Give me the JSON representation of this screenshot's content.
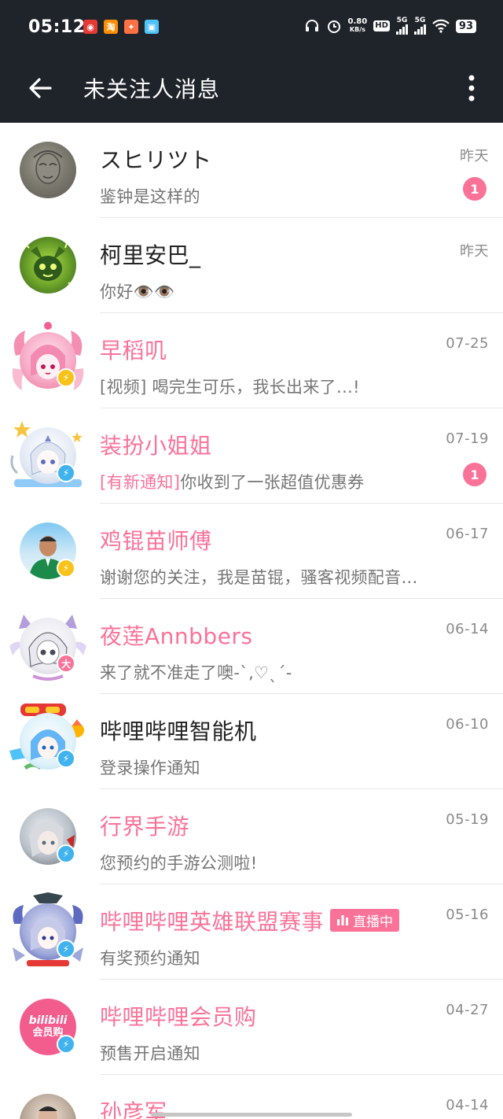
{
  "status_bar": {
    "time": "05:12",
    "net_speed_value": "0.80",
    "net_speed_unit": "KB/s",
    "hd_label": "HD",
    "sim1_label": "5G",
    "sim2_label": "5G",
    "battery": "93"
  },
  "header": {
    "title": "未关注人消息"
  },
  "messages": [
    {
      "name": "スヒリツト",
      "preview": "鉴钟是这样的",
      "date": "昨天",
      "unread": "1"
    },
    {
      "name": "柯里安巴_",
      "preview": "你好👁️👁️",
      "date": "昨天"
    },
    {
      "name": "早稻叽",
      "preview": "[视频] 喝完生可乐，我长出来了…!",
      "date": "07-25"
    },
    {
      "name": "装扮小姐姐",
      "notice_tag": "[有新通知]",
      "preview": "你收到了一张超值优惠券",
      "date": "07-19",
      "unread": "1"
    },
    {
      "name": "鸡锟苗师傅",
      "preview": "谢谢您的关注，我是苗锟，骚客视频配音…",
      "date": "06-17"
    },
    {
      "name": "夜莲Annbbers",
      "preview": "来了就不准走了噢-ˋ,♡ˎˊ-",
      "date": "06-14",
      "badge": "大"
    },
    {
      "name": "哔哩哔哩智能机",
      "preview": "登录操作通知",
      "date": "06-10"
    },
    {
      "name": "行界手游",
      "preview": "您预约的手游公测啦!",
      "date": "05-19"
    },
    {
      "name": "哔哩哔哩英雄联盟赛事",
      "live_label": "直播中",
      "preview": "有奖预约通知",
      "date": "05-16"
    },
    {
      "name": "哔哩哔哩会员购",
      "preview": "预售开启通知",
      "date": "04-27",
      "avatar_text_top": "bilibili",
      "avatar_text_bottom": "会员购"
    },
    {
      "name": "孙彦军",
      "preview": "",
      "date": "04-14"
    }
  ],
  "colors": {
    "bar_bg": "#1f242b",
    "accent_pink": "#fb7299",
    "name_dark": "#222222",
    "preview_gray": "#757575",
    "verify_yellow": "#f7c31a",
    "verify_blue": "#40b3ef"
  }
}
